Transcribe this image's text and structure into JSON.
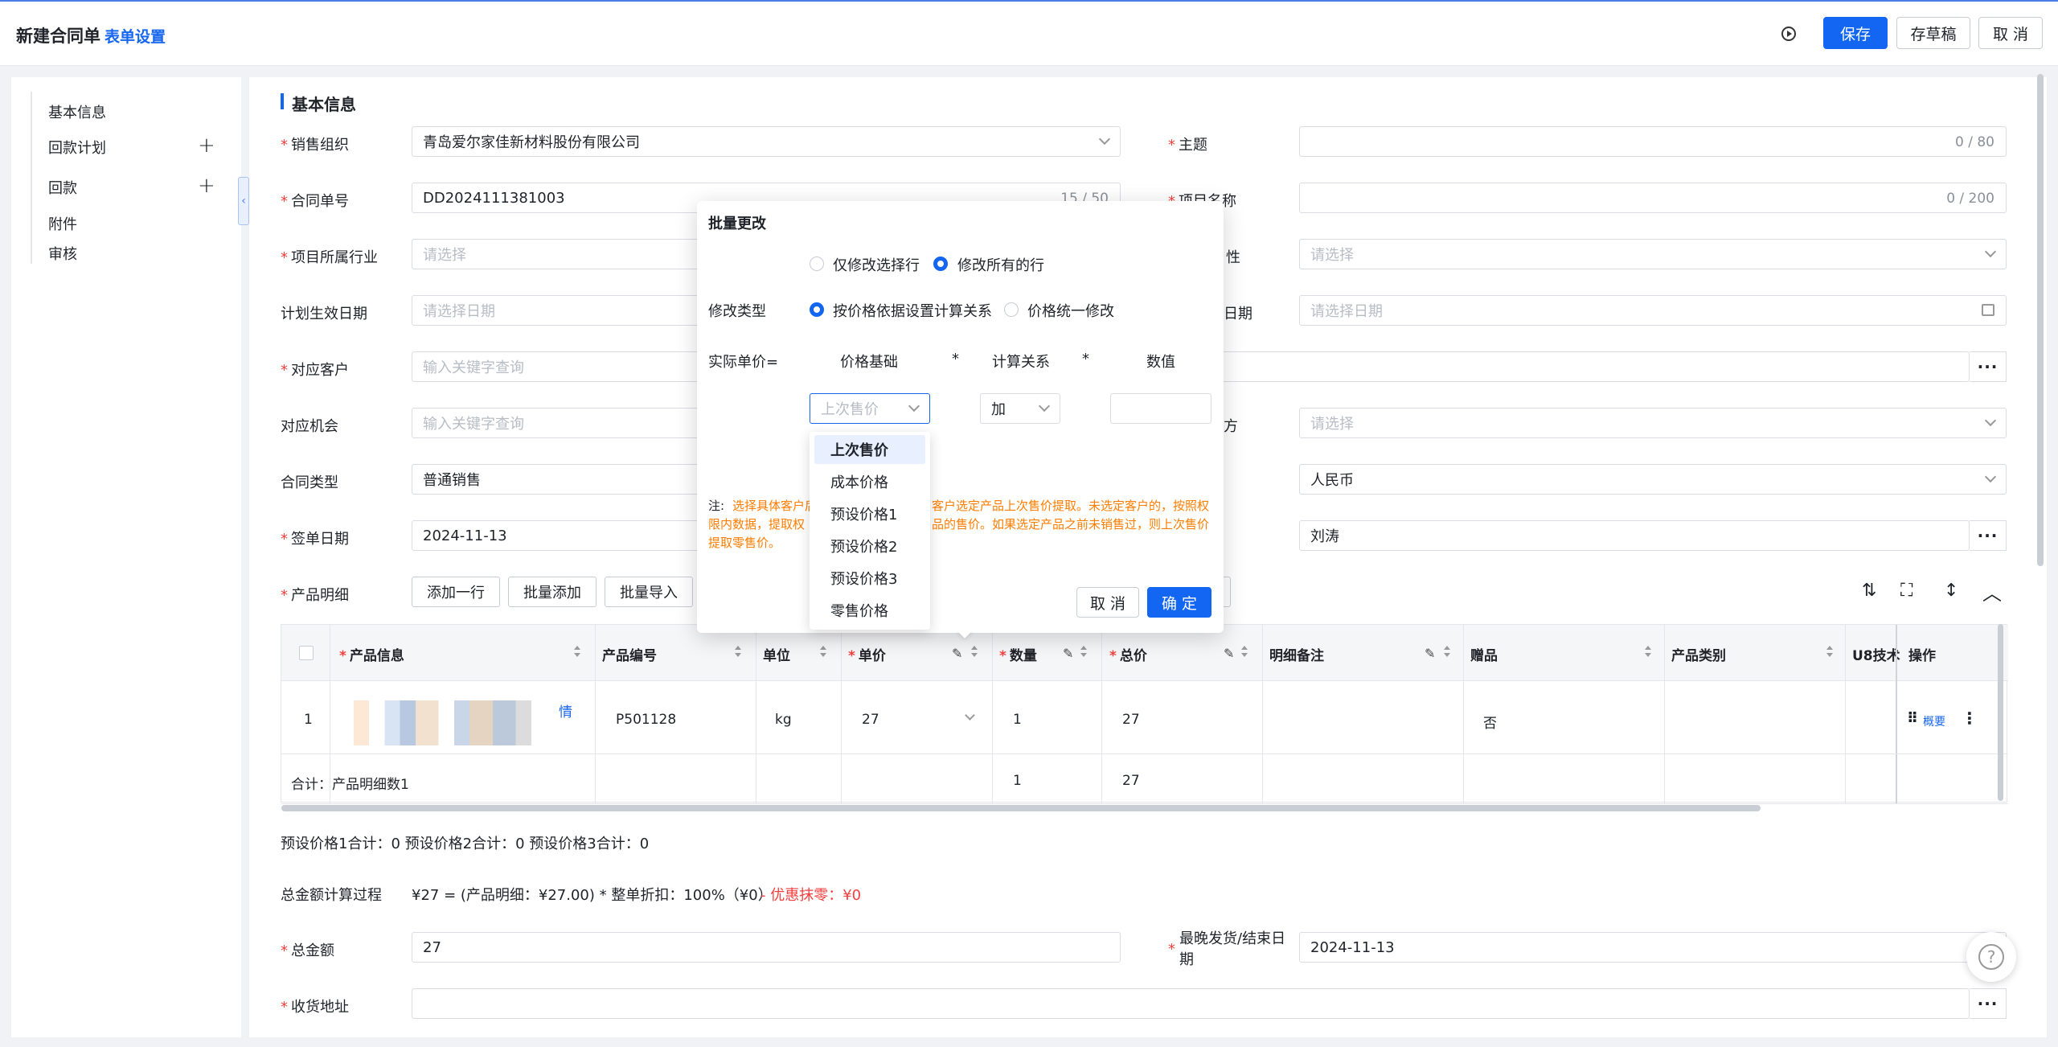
{
  "header": {
    "title": "新建合同单",
    "form_settings": "表单设置",
    "save": "保存",
    "draft": "存草稿",
    "cancel": "取 消"
  },
  "sidebar": {
    "items": [
      {
        "label": "基本信息"
      },
      {
        "label": "回款计划",
        "plus": "+"
      },
      {
        "label": "回款",
        "plus": "+"
      },
      {
        "label": "附件"
      },
      {
        "label": "审核"
      }
    ],
    "collapse_icon": "‹"
  },
  "section": {
    "title": "基本信息"
  },
  "form": {
    "sales_org": {
      "label": "销售组织",
      "value": "青岛爱尔家佳新材料股份有限公司"
    },
    "subject": {
      "label": "主题",
      "count": "0 / 80"
    },
    "contract_no": {
      "label": "合同单号",
      "value": "DD2024111381003",
      "count": "15 / 50"
    },
    "project_name": {
      "label": "项目名称",
      "count": "0 / 200"
    },
    "industry": {
      "label": "项目所属行业",
      "placeholder": "请选择"
    },
    "right3": {
      "label": "性",
      "placeholder": "请选择"
    },
    "effective_date": {
      "label": "计划生效日期",
      "placeholder": "请选择日期"
    },
    "right4": {
      "label": "日期",
      "placeholder": "请选择日期"
    },
    "customer": {
      "label": "对应客户",
      "placeholder": "输入关键字查询"
    },
    "opportunity": {
      "label": "对应机会",
      "placeholder": "输入关键字查询"
    },
    "right6": {
      "label": "方",
      "placeholder": "请选择"
    },
    "contract_type": {
      "label": "合同类型",
      "value": "普通销售"
    },
    "currency": {
      "value": "人民币"
    },
    "sign_date": {
      "label": "签单日期",
      "value": "2024-11-13"
    },
    "owner": {
      "value": "刘涛"
    },
    "product_detail": {
      "label": "产品明细",
      "add_row": "添加一行",
      "batch_add": "批量添加",
      "batch_import": "批量导入"
    },
    "total_amount": {
      "label": "总金额",
      "value": "27"
    },
    "latest_ship": {
      "label": "最晚发货/结束日期",
      "value": "2024-11-13"
    },
    "address": {
      "label": "收货地址"
    }
  },
  "table": {
    "headers": [
      "产品信息",
      "产品编号",
      "单位",
      "单价",
      "数量",
      "总价",
      "明细备注",
      "赠品",
      "产品类别",
      "U8技术",
      "操作"
    ],
    "row": {
      "index": "1",
      "info_link": "情",
      "code": "P501128",
      "unit": "kg",
      "price": "27",
      "qty": "1",
      "total": "27",
      "gift": "否",
      "overview": "概要"
    },
    "sum": {
      "label": "合计：产品明细数1",
      "qty": "1",
      "total": "27"
    }
  },
  "summary": {
    "preset_totals": "预设价格1合计：0  预设价格2合计：0  预设价格3合计：0",
    "calc_label": "总金额计算过程",
    "calc_value": "¥27 =  (产品明细：¥27.00)  * 整单折扣：100%（¥0）",
    "calc_discount": "- 优惠抹零：¥0"
  },
  "modal": {
    "title": "批量更改",
    "scope_selected": "仅修改选择行",
    "scope_all": "修改所有的行",
    "type_label": "修改类型",
    "type_rule": "按价格依据设置计算关系",
    "type_unified": "价格统一修改",
    "actual_price": "实际单价=",
    "col_base": "价格基础",
    "star": "*",
    "col_relation": "计算关系",
    "col_value": "数值",
    "base_placeholder": "上次售价",
    "relation_value": "加",
    "note_prefix": "注:",
    "note_line1": "选择具体客户后",
    "note_line1b": "客户选定产品上次售价提取。未选定客户的，按照权",
    "note_line2": "限内数据，提取权",
    "note_line2b": "品的售价。如果选定产品之前未销售过，则上次售价",
    "note_line3": "提取零售价。",
    "cancel": "取 消",
    "ok": "确 定"
  },
  "dropdown": {
    "options": [
      "上次售价",
      "成本价格",
      "预设价格1",
      "预设价格2",
      "预设价格3",
      "零售价格"
    ],
    "selected": "上次售价"
  },
  "colors": {
    "primary": "#1266f1",
    "required": "#f53f3f",
    "note": "#ff7d00"
  }
}
